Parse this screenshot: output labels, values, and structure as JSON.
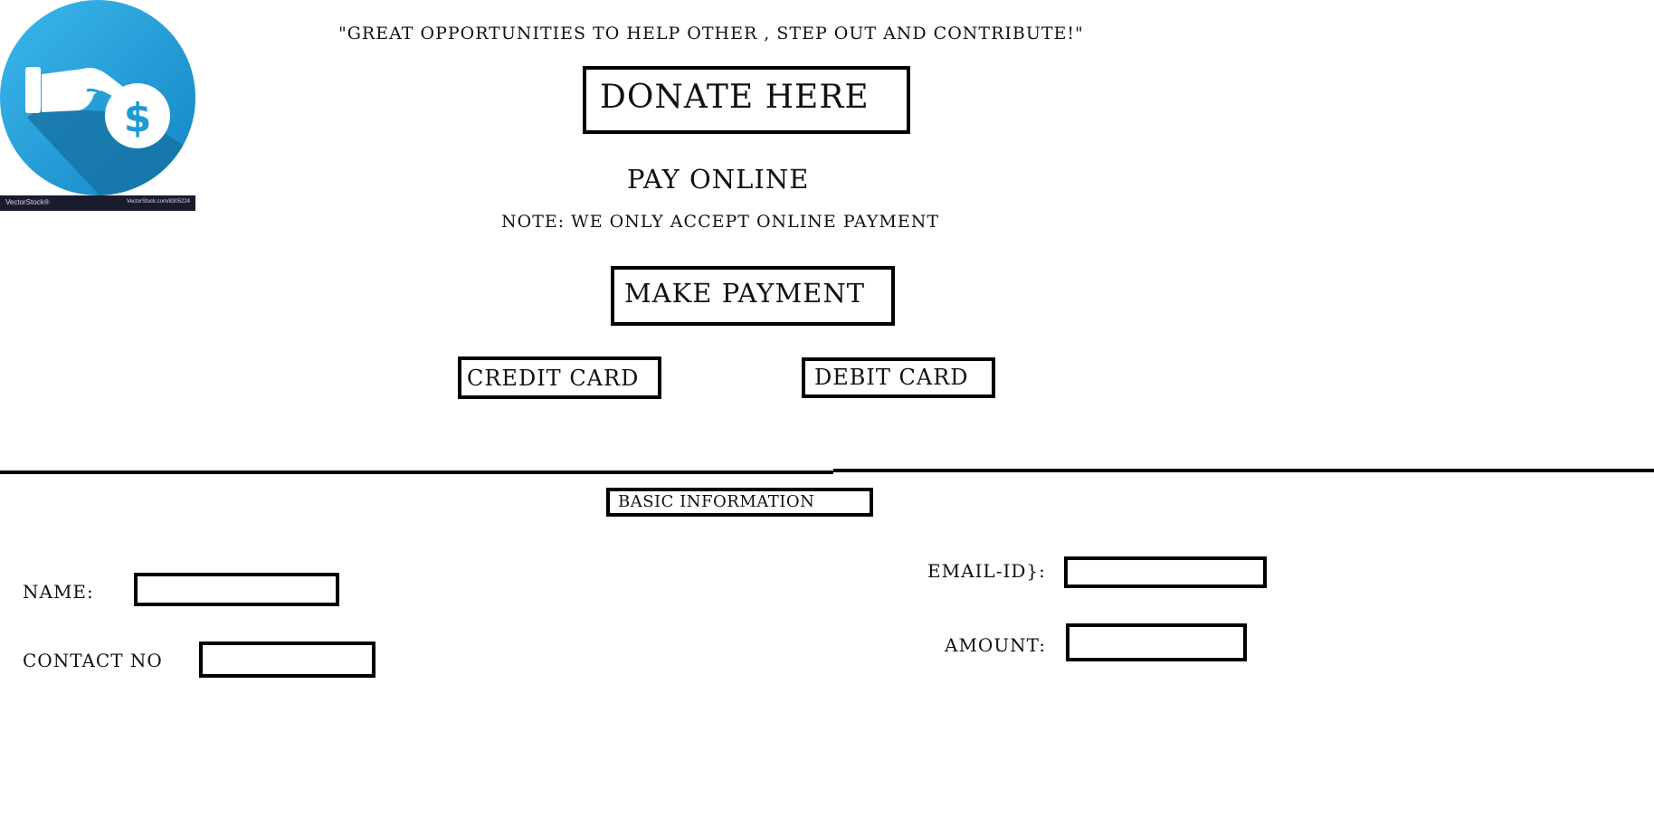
{
  "logo": {
    "icon": "hand-dollar-coin-icon",
    "watermark_left": "VectorStock®",
    "watermark_right": "VectorStock.com/8305224",
    "colors": {
      "circle": "#1e9ad6",
      "circle_light": "#3bb8ec",
      "shadow": "#15709f",
      "coin_symbol": "$"
    }
  },
  "header": {
    "slogan": "\"GREAT OPPORTUNITIES TO HELP OTHER , STEP OUT AND CONTRIBUTE!\"",
    "donate_label": "DONATE HERE"
  },
  "payment": {
    "title": "PAY ONLINE",
    "note": "NOTE: WE ONLY ACCEPT ONLINE PAYMENT",
    "make_payment_label": "MAKE PAYMENT",
    "credit_card_label": "CREDIT CARD",
    "debit_card_label": "DEBIT CARD"
  },
  "basic_info": {
    "title": "BASIC INFORMATION",
    "name_label": "NAME:",
    "name_value": "",
    "contact_label": "CONTACT NO",
    "contact_value": "",
    "email_label": "EMAIL-ID}:",
    "email_value": "",
    "amount_label": "AMOUNT:",
    "amount_value": ""
  }
}
